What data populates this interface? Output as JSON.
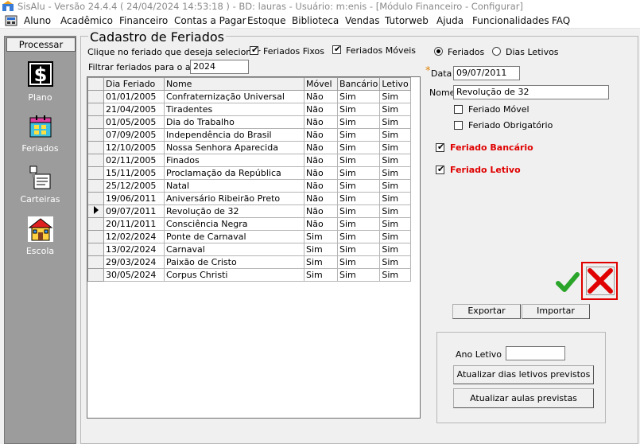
{
  "window": {
    "title": "SisAlu - Versão 24.4.4 ( 24/04/2024 14:53:18 ) - BD: lauras - Usuário: m:enis - [Módulo Financeiro - Configurar]"
  },
  "menu": {
    "items": [
      "Aluno",
      "Acadêmico",
      "Financeiro",
      "Contas a Pagar",
      "Estoque",
      "Biblioteca",
      "Vendas",
      "Tutorweb",
      "Ajuda",
      "Funcionalidades",
      "FAQ"
    ]
  },
  "sidebar": {
    "processar_label": "Processar",
    "items": [
      {
        "label": "Plano",
        "icon": "dollar-icon"
      },
      {
        "label": "Feriados",
        "icon": "calendar-icon"
      },
      {
        "label": "Carteiras",
        "icon": "stamp-icon"
      },
      {
        "label": "Escola",
        "icon": "school-icon"
      }
    ]
  },
  "form": {
    "group_title": "Cadastro de Feriados",
    "instruction": "Clique no feriado que deseja selecionar",
    "fixed_label": "Feriados Fixos",
    "mobile_label": "Feriados Móveis",
    "filter_label": "Filtrar feriados para o ano",
    "filter_value": "2024",
    "radio_feriados": "Feriados",
    "radio_dias_letivos": "Dias Letivos",
    "required_mark": "*",
    "data_label": "Data",
    "data_value": "09/07/2011",
    "nome_label": "Nome",
    "nome_value": "Revolução de 32",
    "feriado_movel_label": "Feriado Móvel",
    "feriado_obrigatorio_label": "Feriado Obrigatório",
    "feriado_bancario_label": "Feriado Bancário",
    "feriado_letivo_label": "Feriado Letivo",
    "exportar_label": "Exportar",
    "importar_label": "Importar",
    "ano_letivo_label": "Ano Letivo",
    "ano_letivo_value": "",
    "atualizar_dias_label": "Atualizar dias letivos previstos",
    "atualizar_aulas_label": "Atualizar aulas previstas",
    "accent_red": "#e00000",
    "ok_color": "#2aa52a"
  },
  "table": {
    "headers": [
      "Dia Feriado",
      "Nome",
      "Móvel",
      "Bancário",
      "Letivo"
    ],
    "selected_index": 9,
    "rows": [
      [
        "01/01/2005",
        "Confraternização Universal",
        "Não",
        "Sim",
        "Sim"
      ],
      [
        "21/04/2005",
        "Tiradentes",
        "Não",
        "Sim",
        "Sim"
      ],
      [
        "01/05/2005",
        "Dia do Trabalho",
        "Não",
        "Sim",
        "Sim"
      ],
      [
        "07/09/2005",
        "Independência do Brasil",
        "Não",
        "Sim",
        "Sim"
      ],
      [
        "12/10/2005",
        "Nossa Senhora Aparecida",
        "Não",
        "Sim",
        "Sim"
      ],
      [
        "02/11/2005",
        "Finados",
        "Não",
        "Sim",
        "Sim"
      ],
      [
        "15/11/2005",
        "Proclamação da República",
        "Não",
        "Sim",
        "Sim"
      ],
      [
        "25/12/2005",
        "Natal",
        "Não",
        "Sim",
        "Sim"
      ],
      [
        "19/06/2011",
        "Aniversário Ribeirão Preto",
        "Não",
        "Sim",
        "Sim"
      ],
      [
        "09/07/2011",
        "Revolução de 32",
        "Não",
        "Sim",
        "Sim"
      ],
      [
        "20/11/2011",
        "Consciência Negra",
        "Não",
        "Sim",
        "Sim"
      ],
      [
        "12/02/2024",
        "Ponte de Carnaval",
        "Sim",
        "Sim",
        "Sim"
      ],
      [
        "13/02/2024",
        "Carnaval",
        "Sim",
        "Sim",
        "Sim"
      ],
      [
        "29/03/2024",
        "Paixão de Cristo",
        "Sim",
        "Sim",
        "Sim"
      ],
      [
        "30/05/2024",
        "Corpus Christi",
        "Sim",
        "Sim",
        "Sim"
      ]
    ]
  }
}
